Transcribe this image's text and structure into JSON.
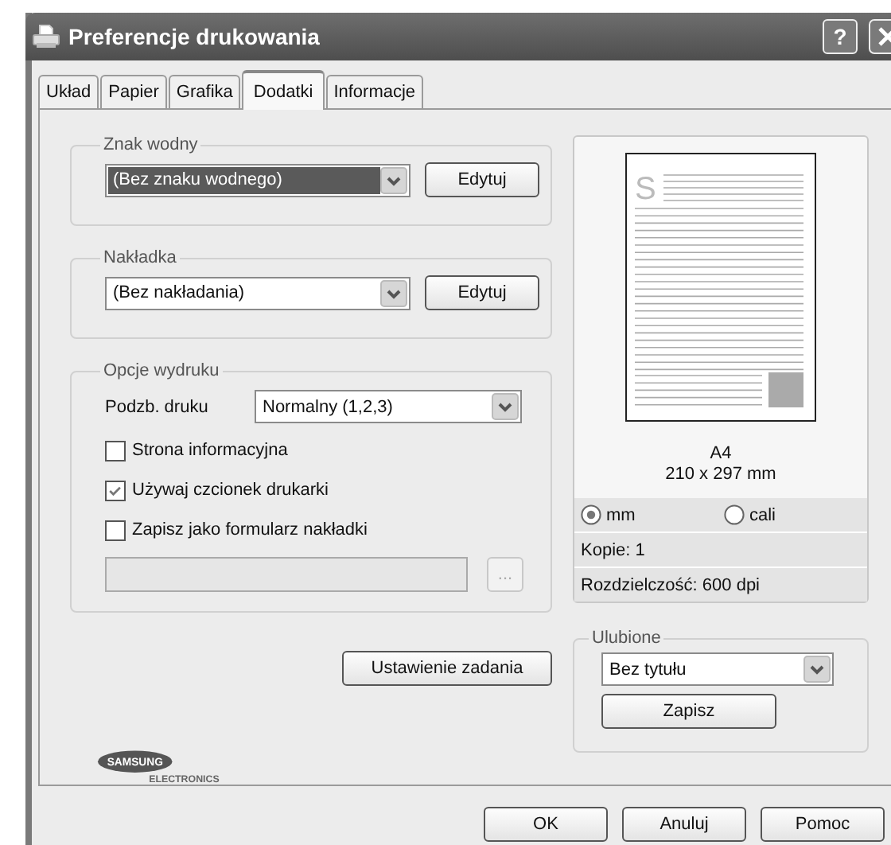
{
  "window": {
    "title": "Preferencje drukowania",
    "help_button": "?"
  },
  "tabs": [
    {
      "label": "Układ",
      "selected": false
    },
    {
      "label": "Papier",
      "selected": false
    },
    {
      "label": "Grafika",
      "selected": false
    },
    {
      "label": "Dodatki",
      "selected": true
    },
    {
      "label": "Informacje",
      "selected": false
    }
  ],
  "watermark": {
    "title": "Znak wodny",
    "value": "(Bez znaku wodnego)",
    "focused": true,
    "edit_button": "Edytuj"
  },
  "overlay": {
    "title": "Nakładka",
    "value": "(Bez nakładania)",
    "focused": false,
    "edit_button": "Edytuj"
  },
  "print_options": {
    "title": "Opcje wydruku",
    "order_label": "Podzb. druku",
    "order_value": "Normalny (1,2,3)",
    "checkboxes": [
      {
        "label": "Strona informacyjna",
        "checked": false
      },
      {
        "label": "Używaj czcionek drukarki",
        "checked": true
      },
      {
        "label": "Zapisz jako formularz nakładki",
        "checked": false
      }
    ],
    "overlay_form": {
      "browse_button": "...",
      "disabled": true
    }
  },
  "job_settings_button": "Ustawienie zadania",
  "preview": {
    "sample_mark": "S",
    "paper": "A4",
    "size": "210 x 297 mm",
    "units": [
      {
        "label": "mm",
        "selected": true
      },
      {
        "label": "cali",
        "selected": false
      }
    ],
    "copies": "Kopie: 1",
    "resolution": "Rozdzielczość: 600 dpi"
  },
  "favorites": {
    "title": "Ulubione",
    "value": "Bez tytułu",
    "save_button": "Zapisz"
  },
  "logo": {
    "brand": "SAMSUNG",
    "subtitle": "ELECTRONICS"
  },
  "buttons": [
    {
      "label": "OK"
    },
    {
      "label": "Anuluj"
    },
    {
      "label": "Pomoc"
    }
  ]
}
